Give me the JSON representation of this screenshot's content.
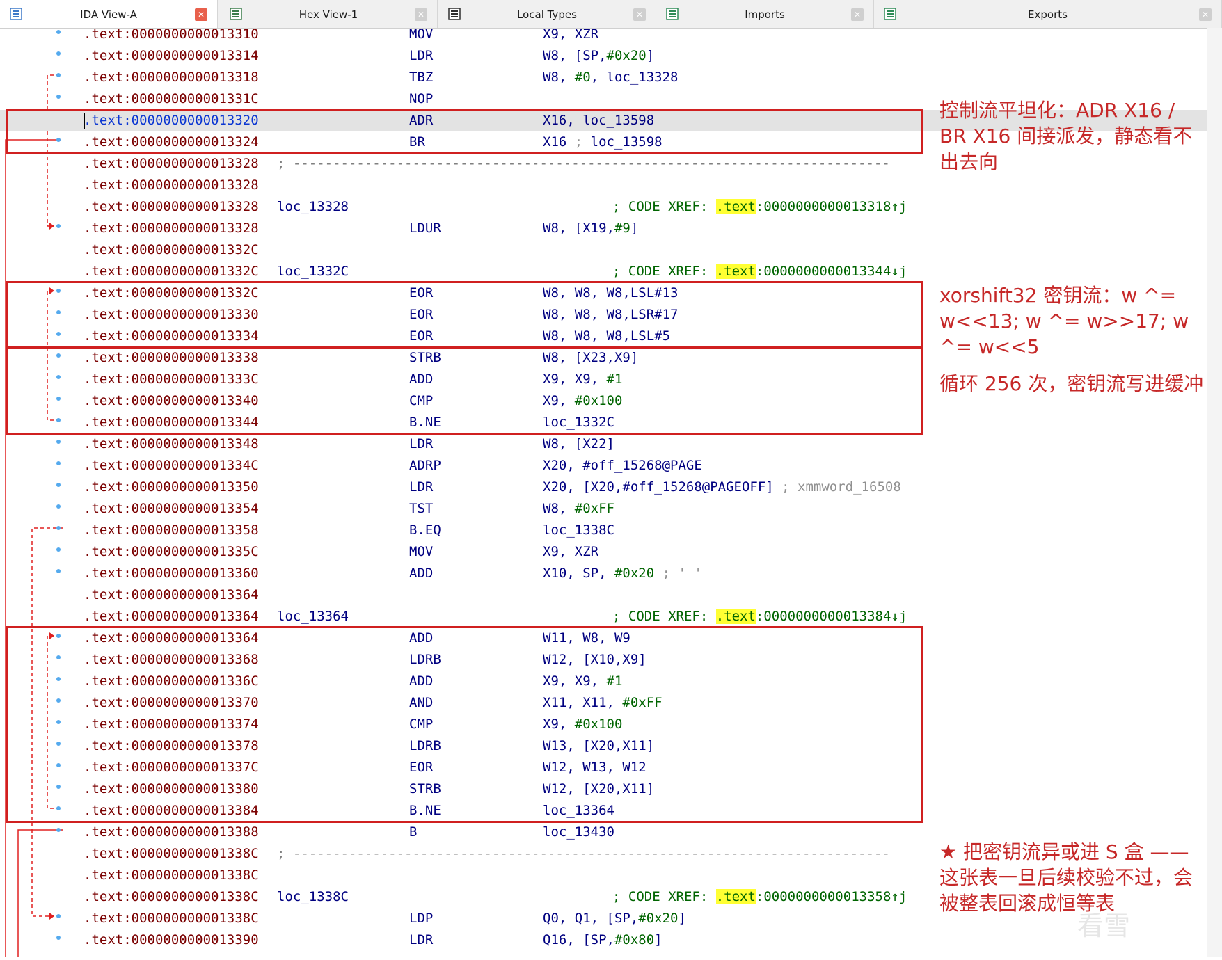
{
  "tabs": [
    {
      "label": "IDA View-A",
      "icon": "listing-view-icon",
      "active": true
    },
    {
      "label": "Hex View-1",
      "icon": "hex-view-icon",
      "active": false
    },
    {
      "label": "Local Types",
      "icon": "local-types-icon",
      "active": false
    },
    {
      "label": "Imports",
      "icon": "imports-icon",
      "active": false
    },
    {
      "label": "Exports",
      "icon": "exports-icon",
      "active": false
    }
  ],
  "close_glyph": "✕",
  "listing": {
    "rows": [
      {
        "type": "insn",
        "addr": ".text:0000000000013310",
        "mnemonic": "MOV",
        "operands": [
          {
            "t": "X9, XZR"
          }
        ]
      },
      {
        "type": "insn",
        "addr": ".text:0000000000013314",
        "mnemonic": "LDR",
        "operands": [
          {
            "t": "W8, [SP,"
          },
          {
            "t": "#0x20",
            "num": true
          },
          {
            "t": "]"
          }
        ]
      },
      {
        "type": "insn",
        "addr": ".text:0000000000013318",
        "mnemonic": "TBZ",
        "operands": [
          {
            "t": "W8, "
          },
          {
            "t": "#0",
            "num": true
          },
          {
            "t": ", loc_13328"
          }
        ]
      },
      {
        "type": "insn",
        "addr": ".text:000000000001331C",
        "mnemonic": "NOP",
        "operands": []
      },
      {
        "type": "insn",
        "addr": ".text:0000000000013320",
        "mnemonic": "ADR",
        "operands": [
          {
            "t": "X16, loc_13598"
          }
        ],
        "highlight": true
      },
      {
        "type": "insn",
        "addr": ".text:0000000000013324",
        "mnemonic": "BR",
        "operands": [
          {
            "t": "X16 "
          },
          {
            "t": "; ",
            "cmt": true
          },
          {
            "t": "loc_13598"
          }
        ]
      },
      {
        "type": "sep",
        "addr": ".text:0000000000013328",
        "sep": "; ---------------------------------------------------------------------------"
      },
      {
        "type": "blank",
        "addr": ".text:0000000000013328"
      },
      {
        "type": "label",
        "addr": ".text:0000000000013328",
        "label": "loc_13328",
        "xref_prefix": "; CODE XREF: ",
        "xref_section": ".text",
        "xref_target": ":0000000000013318↑j"
      },
      {
        "type": "insn",
        "addr": ".text:0000000000013328",
        "mnemonic": "LDUR",
        "operands": [
          {
            "t": "W8, [X19,"
          },
          {
            "t": "#9",
            "num": true
          },
          {
            "t": "]"
          }
        ]
      },
      {
        "type": "blank",
        "addr": ".text:000000000001332C"
      },
      {
        "type": "label",
        "addr": ".text:000000000001332C",
        "label": "loc_1332C",
        "xref_prefix": "; CODE XREF: ",
        "xref_section": ".text",
        "xref_target": ":0000000000013344↓j"
      },
      {
        "type": "insn",
        "addr": ".text:000000000001332C",
        "mnemonic": "EOR",
        "operands": [
          {
            "t": "W8, W8, W8,LSL#13"
          }
        ]
      },
      {
        "type": "insn",
        "addr": ".text:0000000000013330",
        "mnemonic": "EOR",
        "operands": [
          {
            "t": "W8, W8, W8,LSR#17"
          }
        ]
      },
      {
        "type": "insn",
        "addr": ".text:0000000000013334",
        "mnemonic": "EOR",
        "operands": [
          {
            "t": "W8, W8, W8,LSL#5"
          }
        ]
      },
      {
        "type": "insn",
        "addr": ".text:0000000000013338",
        "mnemonic": "STRB",
        "operands": [
          {
            "t": "W8, [X23,X9]"
          }
        ]
      },
      {
        "type": "insn",
        "addr": ".text:000000000001333C",
        "mnemonic": "ADD",
        "operands": [
          {
            "t": "X9, X9, "
          },
          {
            "t": "#1",
            "num": true
          }
        ]
      },
      {
        "type": "insn",
        "addr": ".text:0000000000013340",
        "mnemonic": "CMP",
        "operands": [
          {
            "t": "X9, "
          },
          {
            "t": "#0x100",
            "num": true
          }
        ]
      },
      {
        "type": "insn",
        "addr": ".text:0000000000013344",
        "mnemonic": "B.NE",
        "operands": [
          {
            "t": "loc_1332C"
          }
        ]
      },
      {
        "type": "insn",
        "addr": ".text:0000000000013348",
        "mnemonic": "LDR",
        "operands": [
          {
            "t": "W8, [X22]"
          }
        ]
      },
      {
        "type": "insn",
        "addr": ".text:000000000001334C",
        "mnemonic": "ADRP",
        "operands": [
          {
            "t": "X20, #off_15268@PAGE"
          }
        ]
      },
      {
        "type": "insn",
        "addr": ".text:0000000000013350",
        "mnemonic": "LDR",
        "operands": [
          {
            "t": "X20, [X20,#off_15268@PAGEOFF] "
          },
          {
            "t": "; xmmword_16508",
            "cmt": true
          }
        ]
      },
      {
        "type": "insn",
        "addr": ".text:0000000000013354",
        "mnemonic": "TST",
        "operands": [
          {
            "t": "W8, "
          },
          {
            "t": "#0xFF",
            "num": true
          }
        ]
      },
      {
        "type": "insn",
        "addr": ".text:0000000000013358",
        "mnemonic": "B.EQ",
        "operands": [
          {
            "t": "loc_1338C"
          }
        ]
      },
      {
        "type": "insn",
        "addr": ".text:000000000001335C",
        "mnemonic": "MOV",
        "operands": [
          {
            "t": "X9, XZR"
          }
        ]
      },
      {
        "type": "insn",
        "addr": ".text:0000000000013360",
        "mnemonic": "ADD",
        "operands": [
          {
            "t": "X10, SP, "
          },
          {
            "t": "#0x20",
            "num": true
          },
          {
            "t": " ; ' '",
            "cmt": true
          }
        ]
      },
      {
        "type": "blank",
        "addr": ".text:0000000000013364"
      },
      {
        "type": "label",
        "addr": ".text:0000000000013364",
        "label": "loc_13364",
        "xref_prefix": "; CODE XREF: ",
        "xref_section": ".text",
        "xref_target": ":0000000000013384↓j"
      },
      {
        "type": "insn",
        "addr": ".text:0000000000013364",
        "mnemonic": "ADD",
        "operands": [
          {
            "t": "W11, W8, W9"
          }
        ]
      },
      {
        "type": "insn",
        "addr": ".text:0000000000013368",
        "mnemonic": "LDRB",
        "operands": [
          {
            "t": "W12, [X10,X9]"
          }
        ]
      },
      {
        "type": "insn",
        "addr": ".text:000000000001336C",
        "mnemonic": "ADD",
        "operands": [
          {
            "t": "X9, X9, "
          },
          {
            "t": "#1",
            "num": true
          }
        ]
      },
      {
        "type": "insn",
        "addr": ".text:0000000000013370",
        "mnemonic": "AND",
        "operands": [
          {
            "t": "X11, X11, "
          },
          {
            "t": "#0xFF",
            "num": true
          }
        ]
      },
      {
        "type": "insn",
        "addr": ".text:0000000000013374",
        "mnemonic": "CMP",
        "operands": [
          {
            "t": "X9, "
          },
          {
            "t": "#0x100",
            "num": true
          }
        ]
      },
      {
        "type": "insn",
        "addr": ".text:0000000000013378",
        "mnemonic": "LDRB",
        "operands": [
          {
            "t": "W13, [X20,X11]"
          }
        ]
      },
      {
        "type": "insn",
        "addr": ".text:000000000001337C",
        "mnemonic": "EOR",
        "operands": [
          {
            "t": "W12, W13, W12"
          }
        ]
      },
      {
        "type": "insn",
        "addr": ".text:0000000000013380",
        "mnemonic": "STRB",
        "operands": [
          {
            "t": "W12, [X20,X11]"
          }
        ]
      },
      {
        "type": "insn",
        "addr": ".text:0000000000013384",
        "mnemonic": "B.NE",
        "operands": [
          {
            "t": "loc_13364"
          }
        ]
      },
      {
        "type": "insn",
        "addr": ".text:0000000000013388",
        "mnemonic": "B",
        "operands": [
          {
            "t": "loc_13430"
          }
        ]
      },
      {
        "type": "sep",
        "addr": ".text:000000000001338C",
        "sep": "; ---------------------------------------------------------------------------"
      },
      {
        "type": "blank",
        "addr": ".text:000000000001338C"
      },
      {
        "type": "label",
        "addr": ".text:000000000001338C",
        "label": "loc_1338C",
        "xref_prefix": "; CODE XREF: ",
        "xref_section": ".text",
        "xref_target": ":0000000000013358↑j"
      },
      {
        "type": "insn",
        "addr": ".text:000000000001338C",
        "mnemonic": "LDP",
        "operands": [
          {
            "t": "Q0, Q1, [SP,"
          },
          {
            "t": "#0x20",
            "num": true
          },
          {
            "t": "]"
          }
        ]
      },
      {
        "type": "insn",
        "addr": ".text:0000000000013390",
        "mnemonic": "LDR",
        "operands": [
          {
            "t": "Q16, [SP,"
          },
          {
            "t": "#0x80",
            "num": true
          },
          {
            "t": "]"
          }
        ]
      }
    ]
  },
  "annotations": [
    {
      "text": "控制流平坦化：ADR X16 / BR X16 间接派发，静态看不出去向",
      "box_rows": [
        4,
        5
      ]
    },
    {
      "text": "xorshift32 密钥流：w ^= w<<13; w ^= w>>17; w ^= w<<5",
      "box_rows": [
        12,
        14
      ]
    },
    {
      "text": "循环 256 次，密钥流写进缓冲",
      "box_rows": [
        15,
        18
      ]
    },
    {
      "text": "★ 把密钥流异或进 S 盒 —— 这张表一旦后续校验不过，会被整表回滚成恒等表",
      "box_rows": [
        28,
        36
      ]
    }
  ],
  "colors": {
    "address": "#7a0000",
    "address_current": "#0b36d2",
    "mnemonic": "#000080",
    "immediate": "#006400",
    "comment": "#909090",
    "xref_highlight": "#ffff33",
    "annotation": "#d02020",
    "gutter_dot": "#55aaee"
  },
  "watermark": "看雪"
}
